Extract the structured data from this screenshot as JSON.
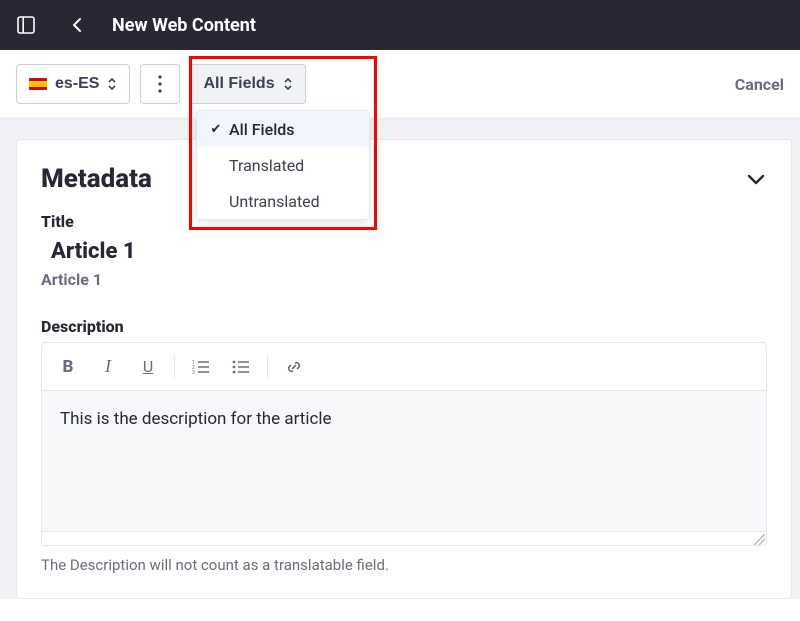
{
  "header": {
    "title": "New Web Content"
  },
  "toolbar": {
    "locale_label": "es-ES",
    "filter_label": "All Fields",
    "cancel_label": "Cancel",
    "dropdown": {
      "items": [
        {
          "label": "All Fields",
          "selected": true
        },
        {
          "label": "Translated",
          "selected": false
        },
        {
          "label": "Untranslated",
          "selected": false
        }
      ]
    }
  },
  "panel": {
    "heading": "Metadata",
    "title_label": "Title",
    "title_value_primary": "Article 1",
    "title_value_secondary": "Article 1",
    "description_label": "Description",
    "description_value": "This is the description for the article",
    "description_helper": "The Description will not count as a translatable field."
  }
}
